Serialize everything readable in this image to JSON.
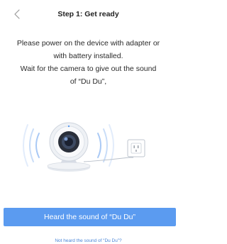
{
  "header": {
    "title": "Step 1: Get ready",
    "back_icon": "chevron-left-icon"
  },
  "instructions": {
    "lines": [
      "Please power on the device with adapter or",
      "with battery installed.",
      "Wait for the camera to give out the sound",
      "of “Du Du”,"
    ]
  },
  "illustration": {
    "camera_icon": "webcam-icon",
    "outlet_icon": "power-outlet-icon",
    "accent_color": "#5b9bf0"
  },
  "actions": {
    "primary_label": "Heard the sound of “Du Du”",
    "secondary_label": "Not heard the sound of “Du Du”?"
  },
  "colors": {
    "primary": "#5b9bf0",
    "link": "#4a86d8",
    "text": "#222222"
  }
}
